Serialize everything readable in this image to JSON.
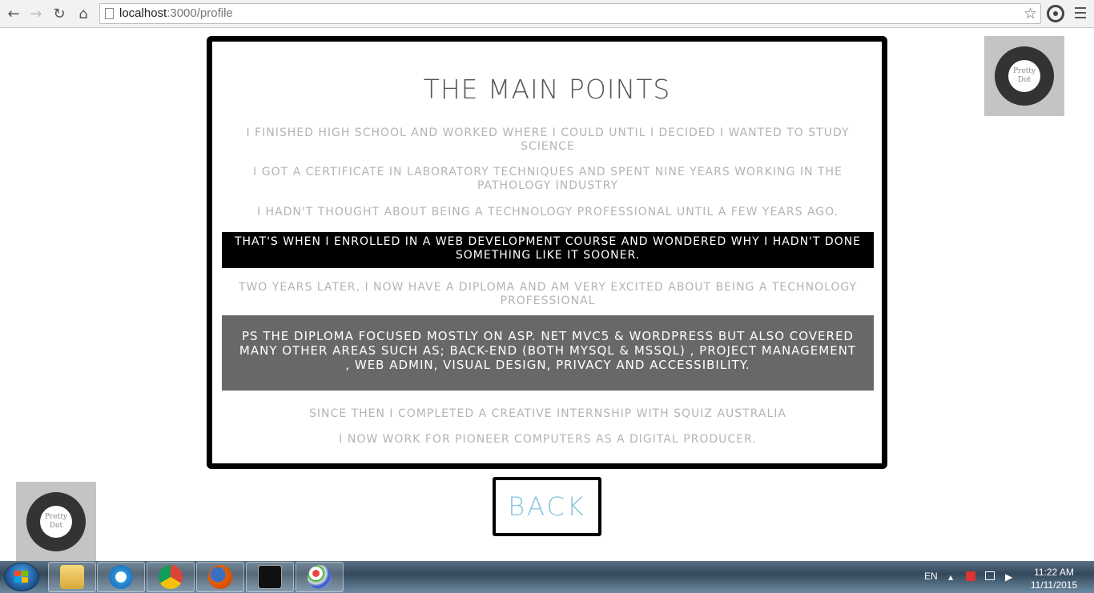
{
  "browser": {
    "url_host": "localhost",
    "url_path": ":3000/profile"
  },
  "card": {
    "title": "THE MAIN POINTS",
    "paragraphs": [
      "I FINISHED HIGH SCHOOL AND WORKED WHERE I COULD UNTIL I DECIDED I WANTED TO STUDY SCIENCE",
      "I GOT A CERTIFICATE IN LABORATORY TECHNIQUES AND SPENT NINE YEARS WORKING IN THE PATHOLOGY INDUSTRY",
      "I HADN'T THOUGHT ABOUT BEING A TECHNOLOGY PROFESSIONAL UNTIL A FEW YEARS AGO.",
      "THAT'S WHEN I ENROLLED IN A WEB DEVELOPMENT COURSE AND WONDERED WHY I HADN'T DONE SOMETHING LIKE IT SOONER.",
      "TWO YEARS LATER, I NOW HAVE A DIPLOMA AND AM VERY EXCITED ABOUT BEING A TECHNOLOGY PROFESSIONAL",
      "PS THE DIPLOMA FOCUSED MOSTLY ON ASP. NET MVC5 & WORDPRESS BUT ALSO COVERED MANY OTHER AREAS SUCH AS; BACK-END (BOTH MYSQL & MSSQL) , PROJECT MANAGEMENT , WEB ADMIN, VISUAL DESIGN, PRIVACY AND ACCESSIBILITY.",
      "SINCE THEN I COMPLETED A CREATIVE INTERNSHIP WITH SQUIZ AUSTRALIA",
      "I NOW WORK FOR PIONEER COMPUTERS AS A DIGITAL PRODUCER."
    ]
  },
  "back_label": "BACK",
  "pretty_dot": {
    "line1": "Pretty",
    "line2": "Dot"
  },
  "taskbar": {
    "language": "EN",
    "time": "11:22 AM",
    "date": "11/11/2015"
  }
}
